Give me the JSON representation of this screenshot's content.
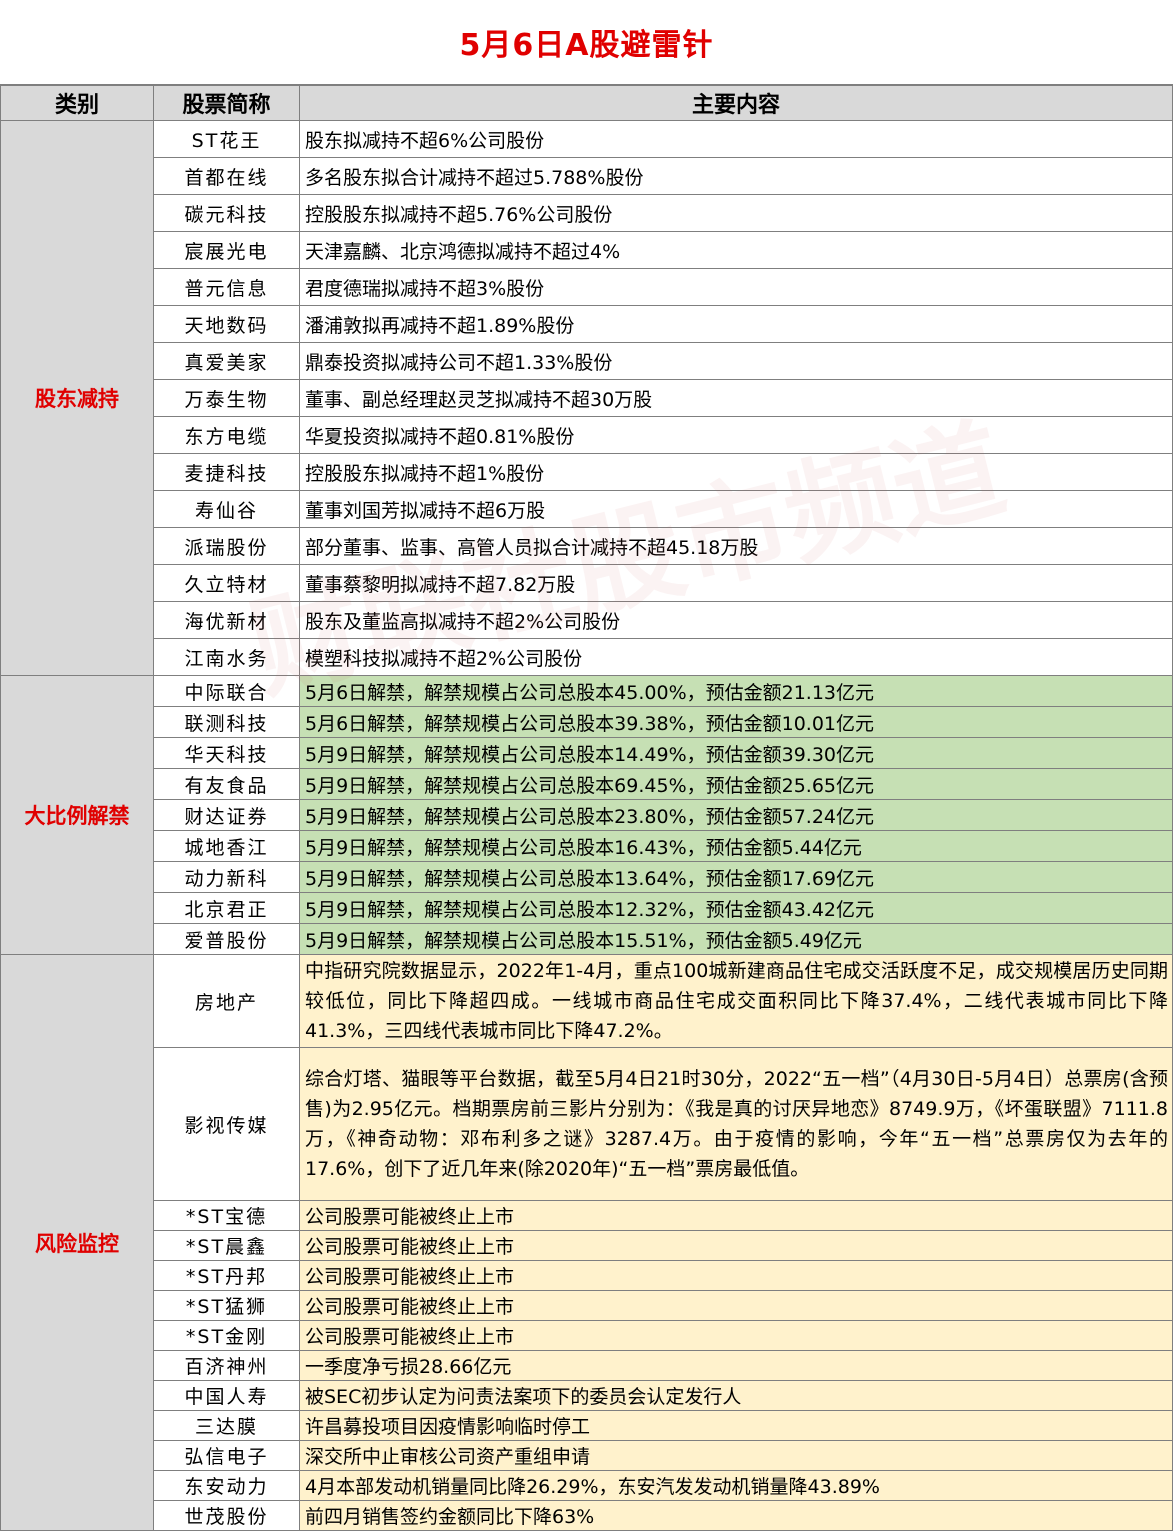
{
  "title": "5月6日A股避雷针",
  "headers": [
    "类别",
    "股票简称",
    "主要内容"
  ],
  "watermark": "财联社股市频道",
  "section1": {
    "category": "股东减持",
    "rows": [
      {
        "name": "ST花王",
        "content": "股东拟减持不超6%公司股份"
      },
      {
        "name": "首都在线",
        "content": "多名股东拟合计减持不超过5.788%股份"
      },
      {
        "name": "碳元科技",
        "content": "控股股东拟减持不超5.76%公司股份"
      },
      {
        "name": "宸展光电",
        "content": "天津嘉麟、北京鸿德拟减持不超过4%"
      },
      {
        "name": "普元信息",
        "content": "君度德瑞拟减持不超3%股份"
      },
      {
        "name": "天地数码",
        "content": "潘浦敦拟再减持不超1.89%股份"
      },
      {
        "name": "真爱美家",
        "content": "鼎泰投资拟减持公司不超1.33%股份"
      },
      {
        "name": "万泰生物",
        "content": "董事、副总经理赵灵芝拟减持不超30万股"
      },
      {
        "name": "东方电缆",
        "content": "华夏投资拟减持不超0.81%股份"
      },
      {
        "name": "麦捷科技",
        "content": "控股股东拟减持不超1%股份"
      },
      {
        "name": "寿仙谷",
        "content": "董事刘国芳拟减持不超6万股"
      },
      {
        "name": "派瑞股份",
        "content": "部分董事、监事、高管人员拟合计减持不超45.18万股"
      },
      {
        "name": "久立特材",
        "content": "董事蔡黎明拟减持不超7.82万股"
      },
      {
        "name": "海优新材",
        "content": "股东及董监高拟减持不超2%公司股份"
      },
      {
        "name": "江南水务",
        "content": "模塑科技拟减持不超2%公司股份"
      }
    ]
  },
  "section2": {
    "category": "大比例解禁",
    "rows": [
      {
        "name": "中际联合",
        "content": "5月6日解禁，解禁规模占公司总股本45.00%，预估金额21.13亿元"
      },
      {
        "name": "联测科技",
        "content": "5月6日解禁，解禁规模占公司总股本39.38%，预估金额10.01亿元"
      },
      {
        "name": "华天科技",
        "content": "5月9日解禁，解禁规模占公司总股本14.49%，预估金额39.30亿元"
      },
      {
        "name": "有友食品",
        "content": "5月9日解禁，解禁规模占公司总股本69.45%，预估金额25.65亿元"
      },
      {
        "name": "财达证券",
        "content": "5月9日解禁，解禁规模占公司总股本23.80%，预估金额57.24亿元"
      },
      {
        "name": "城地香江",
        "content": "5月9日解禁，解禁规模占公司总股本16.43%，预估金额5.44亿元"
      },
      {
        "name": "动力新科",
        "content": "5月9日解禁，解禁规模占公司总股本13.64%，预估金额17.69亿元"
      },
      {
        "name": "北京君正",
        "content": "5月9日解禁，解禁规模占公司总股本12.32%，预估金额43.42亿元"
      },
      {
        "name": "爱普股份",
        "content": "5月9日解禁，解禁规模占公司总股本15.51%，预估金额5.49亿元"
      }
    ]
  },
  "section3": {
    "category": "风险监控",
    "rows": [
      {
        "name": "房地产",
        "content": "中指研究院数据显示，2022年1-4月，重点100城新建商品住宅成交活跃度不足，成交规模居历史同期较低位，同比下降超四成。一线城市商品住宅成交面积同比下降37.4%，二线代表城市同比下降41.3%，三四线代表城市同比下降47.2%。"
      },
      {
        "name": "影视传媒",
        "content": "综合灯塔、猫眼等平台数据，截至5月4日21时30分，2022“五一档”（4月30日-5月4日）总票房(含预售)为2.95亿元。档期票房前三影片分别为：《我是真的讨厌异地恋》8749.9万，《坏蛋联盟》7111.8万，《神奇动物：邓布利多之谜》3287.4万。由于疫情的影响，今年“五一档”总票房仅为去年的17.6%，创下了近几年来(除2020年)“五一档”票房最低值。"
      },
      {
        "name": "*ST宝德",
        "content": "公司股票可能被终止上市"
      },
      {
        "name": "*ST晨鑫",
        "content": "公司股票可能被终止上市"
      },
      {
        "name": "*ST丹邦",
        "content": "公司股票可能被终止上市"
      },
      {
        "name": "*ST猛狮",
        "content": "公司股票可能被终止上市"
      },
      {
        "name": "*ST金刚",
        "content": "公司股票可能被终止上市"
      },
      {
        "name": "百济神州",
        "content": "一季度净亏损28.66亿元"
      },
      {
        "name": "中国人寿",
        "content": "被SEC初步认定为问责法案项下的委员会认定发行人"
      },
      {
        "name": "三达膜",
        "content": "许昌募投项目因疫情影响临时停工"
      },
      {
        "name": "弘信电子",
        "content": "深交所中止审核公司资产重组申请"
      },
      {
        "name": "东安动力",
        "content": "4月本部发动机销量同比降26.29%，东安汽发发动机销量降43.89%"
      },
      {
        "name": "世茂股份",
        "content": "前四月销售签约金额同比下降63%"
      }
    ]
  },
  "colors": {
    "title": "#e00000",
    "header_bg": "#d9d9d9",
    "unlock_bg": "#c6e0b4",
    "risk_bg": "#fff2cc"
  }
}
